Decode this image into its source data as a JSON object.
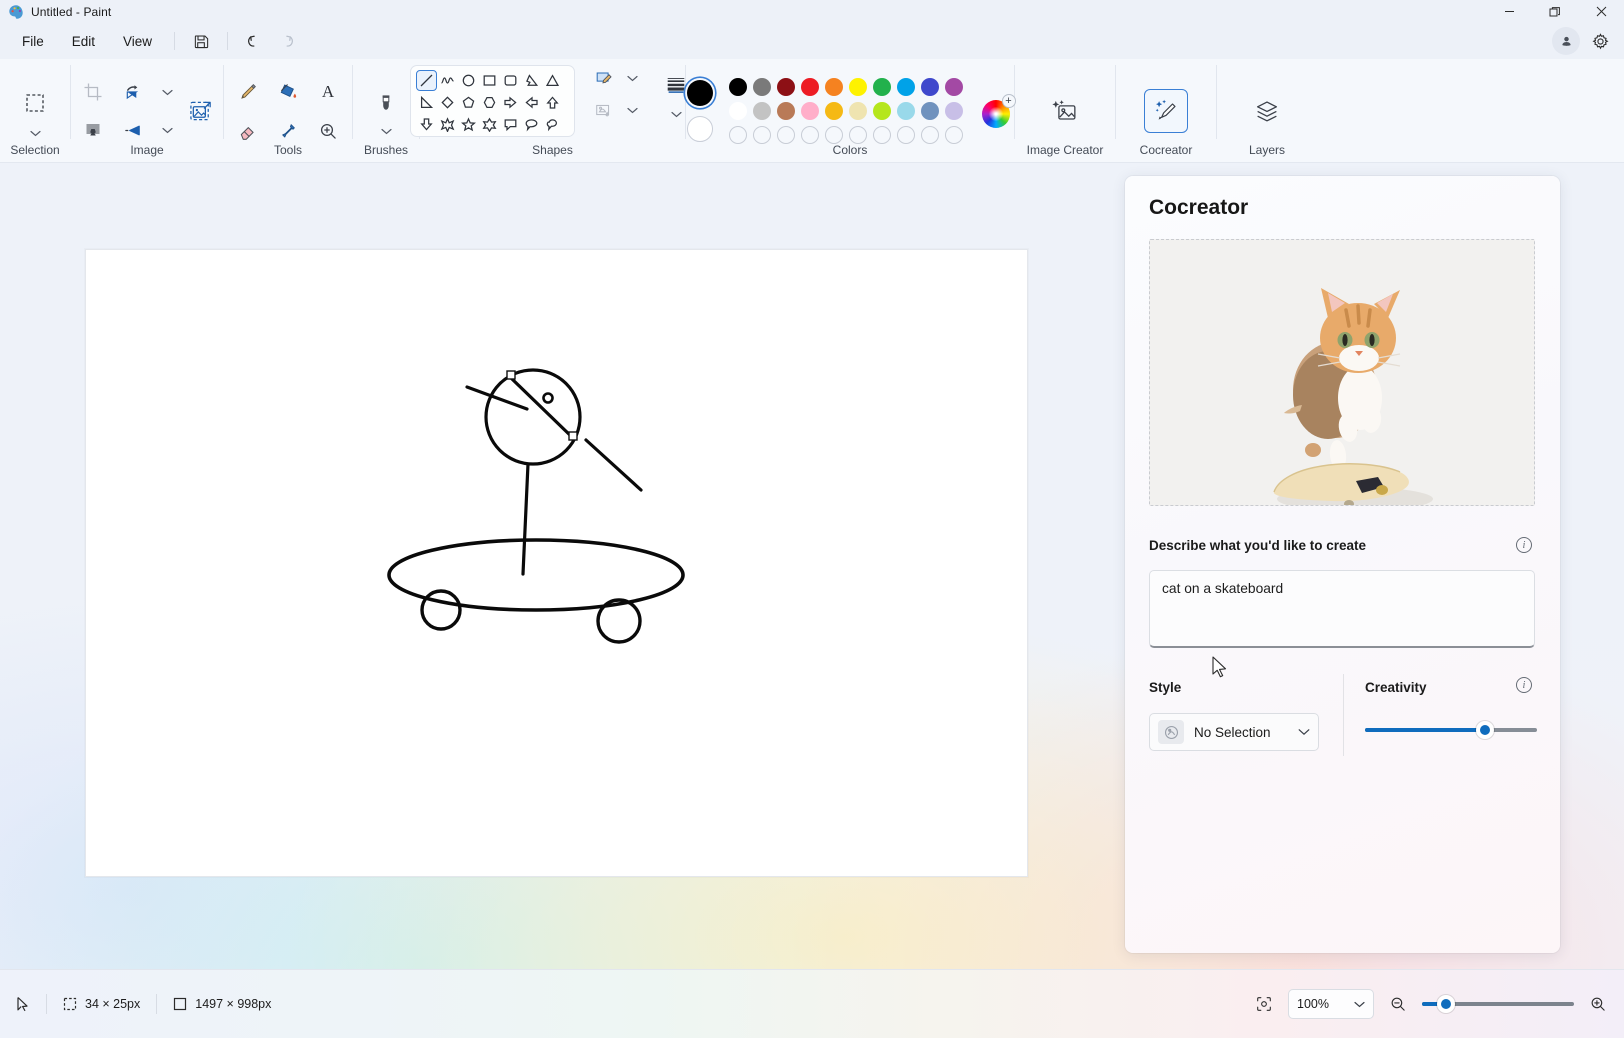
{
  "window": {
    "title": "Untitled - Paint",
    "app_icon": "paint-palette-icon",
    "minimize": "minimize-icon",
    "restore": "restore-icon",
    "close": "close-icon"
  },
  "menubar": {
    "items": [
      {
        "label": "File",
        "name": "menu-file"
      },
      {
        "label": "Edit",
        "name": "menu-edit"
      },
      {
        "label": "View",
        "name": "menu-view"
      }
    ],
    "save_icon": "save-icon",
    "undo_icon": "undo-icon",
    "redo_icon": "redo-icon",
    "account_icon": "account-icon",
    "settings_icon": "gear-icon"
  },
  "ribbon": {
    "groups": [
      {
        "label": "Selection",
        "name": "group-selection"
      },
      {
        "label": "Image",
        "name": "group-image"
      },
      {
        "label": "Tools",
        "name": "group-tools"
      },
      {
        "label": "Brushes",
        "name": "group-brushes"
      },
      {
        "label": "Shapes",
        "name": "group-shapes"
      },
      {
        "label": "Colors",
        "name": "group-colors"
      },
      {
        "label": "Image Creator",
        "name": "group-image-creator"
      },
      {
        "label": "Cocreator",
        "name": "group-cocreator"
      },
      {
        "label": "Layers",
        "name": "group-layers"
      }
    ],
    "shapes": {
      "selected": "line",
      "items": [
        "line",
        "curve",
        "oval",
        "rectangle",
        "rounded-rectangle",
        "polygon",
        "triangle",
        "right-triangle",
        "diamond",
        "pentagon",
        "hexagon",
        "arrow-right",
        "arrow-left",
        "arrow-up",
        "arrow-down",
        "four-point-star",
        "five-point-star",
        "six-point-star",
        "callout-rect",
        "callout-round",
        "callout-cloud"
      ],
      "outline_icon": "shape-outline-icon",
      "fill_icon": "shape-fill-icon",
      "thickness_icon": "shape-thickness-icon"
    },
    "colors": {
      "current_primary": "#000000",
      "current_secondary": "#ffffff",
      "row1": [
        "#000000",
        "#7a7a7a",
        "#8d1015",
        "#ed1c24",
        "#f58220",
        "#fef200",
        "#22b14c",
        "#00a2e8",
        "#3f48cc",
        "#a349a4"
      ],
      "row2": [
        "#ffffff",
        "#c3c3c3",
        "#b97a57",
        "#ffaec9",
        "#f5b915",
        "#efe4b0",
        "#b5e61d",
        "#99d9ea",
        "#7092be",
        "#c8bfe7"
      ],
      "row3": [
        "",
        "",
        "",
        "",
        "",
        "",
        "",
        "",
        "",
        ""
      ],
      "picker_icon": "color-wheel-icon",
      "add_color_icon": "plus-icon"
    }
  },
  "cocreator": {
    "title": "Cocreator",
    "preview_alt": "generated-cat-on-skateboard-preview",
    "prompt_label": "Describe what you'd like to create",
    "prompt_value": "cat on a skateboard",
    "prompt_placeholder": "Describe what you'd like to create",
    "prompt_info_icon": "info-icon",
    "style_label": "Style",
    "style_value": "No Selection",
    "style_chevron_icon": "chevron-down-icon",
    "creativity_label": "Creativity",
    "creativity_info_icon": "info-icon",
    "creativity_value": 70
  },
  "statusbar": {
    "cursor_icon": "cursor-arrow-icon",
    "selection_icon": "selection-size-icon",
    "selection_size": "34 × 25px",
    "canvas_icon": "canvas-size-icon",
    "canvas_size": "1497 × 998px",
    "fit_icon": "fit-to-window-icon",
    "zoom_value": "100%",
    "zoom_chevron_icon": "chevron-down-icon",
    "zoom_out_icon": "zoom-out-icon",
    "zoom_in_icon": "zoom-in-icon",
    "zoom_slider_value": 10
  }
}
